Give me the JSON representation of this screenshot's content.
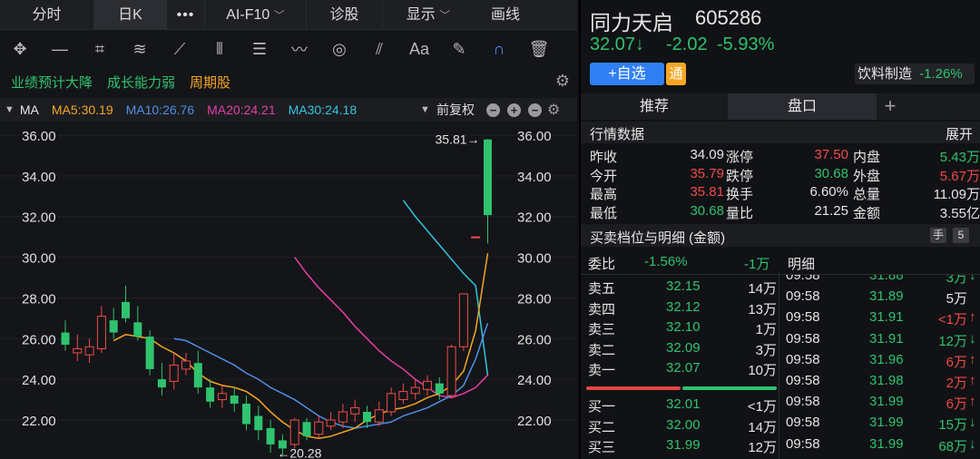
{
  "nav": {
    "tabs": [
      "分时",
      "日K",
      "•••",
      "AI-F10",
      "诊股"
    ],
    "display": "显示",
    "draw": "画线"
  },
  "tags": [
    "业绩预计大降",
    "成长能力弱",
    "周期股"
  ],
  "ma": {
    "label": "MA",
    "ma5": "MA5:30.19",
    "ma10": "MA10:26.76",
    "ma20": "MA20:24.21",
    "ma30": "MA30:24.18",
    "adjust": "前复权"
  },
  "colors": {
    "ma5": "#f5a623",
    "ma10": "#4e8fe6",
    "ma20": "#e53ea9",
    "ma30": "#33c6e0",
    "up": "#ef4c4c",
    "down": "#2fc36e"
  },
  "chart_data": {
    "type": "candlestick",
    "y_ticks": [
      "36.00",
      "34.00",
      "32.00",
      "30.00",
      "28.00",
      "26.00",
      "24.00",
      "22.00"
    ],
    "ylim": [
      20.0,
      36.6
    ],
    "high_label": "35.81",
    "low_label": "20.28",
    "candles": [
      {
        "o": 26.3,
        "c": 25.7,
        "h": 26.9,
        "l": 25.4
      },
      {
        "o": 25.3,
        "c": 25.5,
        "h": 26.2,
        "l": 24.9
      },
      {
        "o": 25.2,
        "c": 25.6,
        "h": 26.0,
        "l": 24.8
      },
      {
        "o": 25.5,
        "c": 27.1,
        "h": 27.6,
        "l": 25.3
      },
      {
        "o": 26.9,
        "c": 26.3,
        "h": 27.5,
        "l": 26.0
      },
      {
        "o": 27.8,
        "c": 27.0,
        "h": 28.6,
        "l": 26.8
      },
      {
        "o": 26.8,
        "c": 26.1,
        "h": 27.6,
        "l": 25.9
      },
      {
        "o": 26.1,
        "c": 24.5,
        "h": 26.4,
        "l": 24.2
      },
      {
        "o": 24.0,
        "c": 23.6,
        "h": 24.8,
        "l": 23.2
      },
      {
        "o": 23.9,
        "c": 24.7,
        "h": 25.3,
        "l": 23.5
      },
      {
        "o": 24.5,
        "c": 24.9,
        "h": 25.3,
        "l": 24.2
      },
      {
        "o": 24.8,
        "c": 23.6,
        "h": 25.4,
        "l": 23.3
      },
      {
        "o": 23.6,
        "c": 22.9,
        "h": 24.0,
        "l": 22.6
      },
      {
        "o": 23.0,
        "c": 23.3,
        "h": 23.7,
        "l": 22.6
      },
      {
        "o": 23.2,
        "c": 22.8,
        "h": 23.6,
        "l": 22.4
      },
      {
        "o": 22.8,
        "c": 21.8,
        "h": 23.2,
        "l": 21.5
      },
      {
        "o": 22.2,
        "c": 21.5,
        "h": 22.7,
        "l": 21.0
      },
      {
        "o": 21.6,
        "c": 20.8,
        "h": 22.0,
        "l": 20.4
      },
      {
        "o": 21.0,
        "c": 20.6,
        "h": 21.3,
        "l": 20.28
      },
      {
        "o": 20.8,
        "c": 22.0,
        "h": 22.1,
        "l": 20.6
      },
      {
        "o": 21.9,
        "c": 21.2,
        "h": 22.1,
        "l": 21.0
      },
      {
        "o": 21.3,
        "c": 21.9,
        "h": 22.2,
        "l": 21.1
      },
      {
        "o": 21.7,
        "c": 22.0,
        "h": 22.4,
        "l": 21.5
      },
      {
        "o": 21.9,
        "c": 22.4,
        "h": 22.8,
        "l": 21.6
      },
      {
        "o": 22.3,
        "c": 22.6,
        "h": 23.0,
        "l": 21.9
      },
      {
        "o": 22.4,
        "c": 21.9,
        "h": 22.7,
        "l": 21.6
      },
      {
        "o": 21.9,
        "c": 22.5,
        "h": 22.9,
        "l": 21.7
      },
      {
        "o": 22.4,
        "c": 23.3,
        "h": 23.6,
        "l": 22.2
      },
      {
        "o": 23.0,
        "c": 23.4,
        "h": 23.8,
        "l": 22.8
      },
      {
        "o": 23.3,
        "c": 23.6,
        "h": 24.0,
        "l": 23.0
      },
      {
        "o": 23.5,
        "c": 23.9,
        "h": 24.2,
        "l": 23.2
      },
      {
        "o": 23.8,
        "c": 23.3,
        "h": 24.1,
        "l": 23.0
      },
      {
        "o": 23.2,
        "c": 25.6,
        "h": 25.7,
        "l": 23.1
      },
      {
        "o": 25.6,
        "c": 28.2,
        "h": 28.2,
        "l": 25.4
      },
      {
        "o": 31.0,
        "c": 31.0,
        "h": 31.0,
        "l": 31.0
      },
      {
        "o": 35.79,
        "c": 32.07,
        "h": 35.81,
        "l": 30.68
      }
    ],
    "ma5": [
      null,
      null,
      null,
      null,
      25.9,
      26.2,
      26.1,
      26.0,
      25.6,
      25.3,
      24.9,
      24.3,
      23.9,
      23.7,
      23.6,
      23.4,
      23.0,
      22.4,
      21.9,
      21.5,
      21.2,
      21.1,
      21.2,
      21.4,
      21.6,
      22.0,
      22.3,
      22.5,
      22.6,
      22.8,
      23.1,
      23.3,
      23.7,
      24.4,
      26.4,
      30.19
    ],
    "ma10": [
      null,
      null,
      null,
      null,
      null,
      null,
      null,
      null,
      null,
      26.0,
      25.9,
      25.6,
      25.3,
      25.0,
      24.7,
      24.3,
      24.0,
      23.6,
      23.3,
      23.0,
      22.6,
      22.2,
      21.9,
      21.7,
      21.6,
      21.7,
      21.8,
      21.9,
      22.2,
      22.4,
      22.6,
      22.9,
      23.2,
      23.7,
      25.0,
      26.76
    ],
    "ma20": [
      null,
      null,
      null,
      null,
      null,
      null,
      null,
      null,
      null,
      null,
      null,
      null,
      null,
      null,
      null,
      null,
      null,
      null,
      null,
      30.0,
      29.2,
      28.5,
      27.9,
      27.3,
      26.6,
      26.0,
      25.4,
      24.9,
      24.5,
      24.0,
      23.6,
      23.2,
      23.1,
      23.3,
      23.6,
      24.21
    ],
    "ma30": [
      null,
      null,
      null,
      null,
      null,
      null,
      null,
      null,
      null,
      null,
      null,
      null,
      null,
      null,
      null,
      null,
      null,
      null,
      null,
      null,
      null,
      null,
      null,
      null,
      null,
      null,
      null,
      null,
      32.8,
      32.0,
      31.3,
      30.6,
      29.9,
      29.2,
      28.6,
      24.18
    ]
  },
  "stock": {
    "name": "同力天启",
    "code": "605286",
    "price": "32.07↓",
    "change": "-2.02",
    "change_pct": "-5.93%",
    "watch_btn": "+自选",
    "tong": "通",
    "sector": "饮料制造",
    "sector_pct": "-1.26%"
  },
  "tabs": [
    "推荐",
    "盘口",
    "+"
  ],
  "quote": {
    "title": "行情数据",
    "expand": "展开",
    "rows": [
      [
        "昨收",
        "34.09",
        "涨停",
        "37.50",
        "内盘",
        "5.43万"
      ],
      [
        "今开",
        "35.79",
        "跌停",
        "30.68",
        "外盘",
        "5.67万"
      ],
      [
        "最高",
        "35.81",
        "换手",
        "6.60%",
        "总量",
        "11.09万"
      ],
      [
        "最低",
        "30.68",
        "量比",
        "21.25",
        "金额",
        "3.55亿"
      ]
    ]
  },
  "book": {
    "title": "买卖档位与明细 (金额)",
    "hand": "手",
    "five": "5",
    "weibi_label": "委比",
    "weibi_pct": "-1.56%",
    "weibi_amt": "-1万",
    "sells": [
      [
        "卖五",
        "32.15",
        "14万"
      ],
      [
        "卖四",
        "32.12",
        "13万"
      ],
      [
        "卖三",
        "32.10",
        "1万"
      ],
      [
        "卖二",
        "32.09",
        "3万"
      ],
      [
        "卖一",
        "32.07",
        "10万"
      ]
    ],
    "buys": [
      [
        "买一",
        "32.01",
        "<1万"
      ],
      [
        "买二",
        "32.00",
        "14万"
      ],
      [
        "买三",
        "31.99",
        "12万"
      ]
    ],
    "detail_title": "明细",
    "details": [
      [
        "09:58",
        "31.88",
        "3万",
        "↓"
      ],
      [
        "09:58",
        "31.89",
        "5万",
        ""
      ],
      [
        "09:58",
        "31.91",
        "<1万",
        "↑"
      ],
      [
        "09:58",
        "31.91",
        "12万",
        "↓"
      ],
      [
        "09:58",
        "31.96",
        "6万",
        "↑"
      ],
      [
        "09:58",
        "31.98",
        "2万",
        "↑"
      ],
      [
        "09:58",
        "31.99",
        "6万",
        "↑"
      ],
      [
        "09:58",
        "31.99",
        "15万",
        "↓"
      ],
      [
        "09:58",
        "31.99",
        "68万",
        "↓"
      ]
    ]
  }
}
